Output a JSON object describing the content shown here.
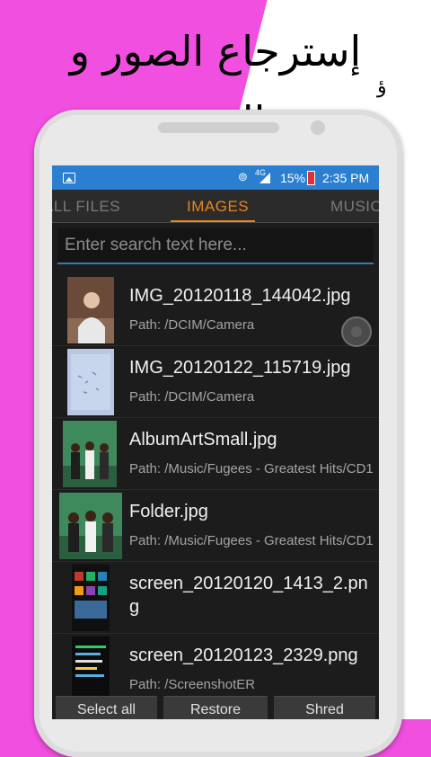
{
  "promo": {
    "title": "إسترجاع الصور و الفديو",
    "mark": "ؤ"
  },
  "status_bar": {
    "network": "4G",
    "battery": "15%",
    "time": "2:35 PM"
  },
  "tabs": [
    {
      "label": "ALL FILES",
      "active": false
    },
    {
      "label": "IMAGES",
      "active": true
    },
    {
      "label": "MUSIC",
      "active": false
    }
  ],
  "search": {
    "placeholder": "Enter search text here..."
  },
  "files": [
    {
      "name": "IMG_20120118_144042.jpg",
      "path": "Path: /DCIM/Camera",
      "thumb": "photo-person"
    },
    {
      "name": "IMG_20120122_115719.jpg",
      "path": "Path: /DCIM/Camera",
      "thumb": "photo-paper"
    },
    {
      "name": "AlbumArtSmall.jpg",
      "path": "Path: /Music/Fugees - Greatest Hits/CD1",
      "thumb": "album-cover"
    },
    {
      "name": "Folder.jpg",
      "path": "Path: /Music/Fugees - Greatest Hits/CD1",
      "thumb": "album-cover"
    },
    {
      "name": "screen_20120120_1413_2.png",
      "path": "",
      "thumb": "screenshot"
    },
    {
      "name": "screen_20120123_2329.png",
      "path": "Path: /ScreenshotER",
      "thumb": "screenshot"
    }
  ],
  "actions": {
    "select_all": "Select all",
    "restore": "Restore",
    "shred": "Shred"
  },
  "colors": {
    "accent": "#e8861e",
    "status_bar": "#2a7fd0",
    "promo_background": "#f04fe0"
  }
}
